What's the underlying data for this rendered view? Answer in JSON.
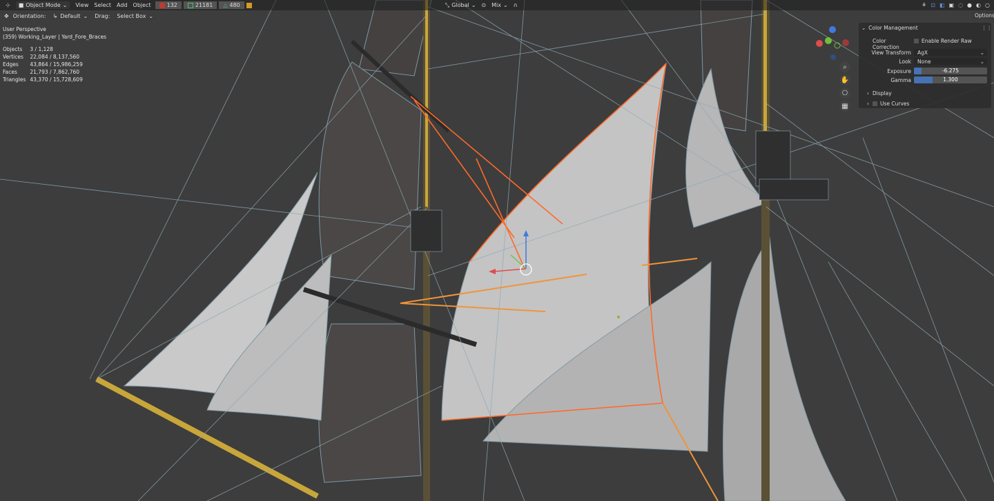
{
  "header": {
    "mode": "Object Mode",
    "menus": [
      "View",
      "Select",
      "Add",
      "Object"
    ],
    "stats": [
      "132",
      "21181",
      "480"
    ],
    "transform": "Global",
    "mix": "Mix"
  },
  "toolbar": {
    "orientation_label": "Orientation:",
    "orientation_value": "Default",
    "drag_label": "Drag:",
    "drag_value": "Select Box",
    "options": "Options"
  },
  "overlay": {
    "view": "User Perspective",
    "collection": "(359) Working_Layer | Yard_Fore_Braces",
    "rows": [
      {
        "label": "Objects",
        "value": "3 / 1,128"
      },
      {
        "label": "Vertices",
        "value": "22,084 / 8,137,560"
      },
      {
        "label": "Edges",
        "value": "43,864 / 15,986,259"
      },
      {
        "label": "Faces",
        "value": "21,793 / 7,862,760"
      },
      {
        "label": "Triangles",
        "value": "43,370 / 15,728,609"
      }
    ]
  },
  "panel": {
    "title": "Color Management",
    "color_correction": "Color Correction",
    "enable_raw": "Enable Render Raw",
    "view_transform_label": "View Transform",
    "view_transform": "AgX",
    "look_label": "Look",
    "look": "None",
    "exposure_label": "Exposure",
    "exposure": "-6.275",
    "exposure_fill": 0.1,
    "gamma_label": "Gamma",
    "gamma": "1.300",
    "gamma_fill": 0.25,
    "display": "Display",
    "use_curves": "Use Curves"
  },
  "colors": {
    "accent": "#4772b3",
    "selection": "#ff6a2a",
    "wire": "#8fa8b5"
  }
}
